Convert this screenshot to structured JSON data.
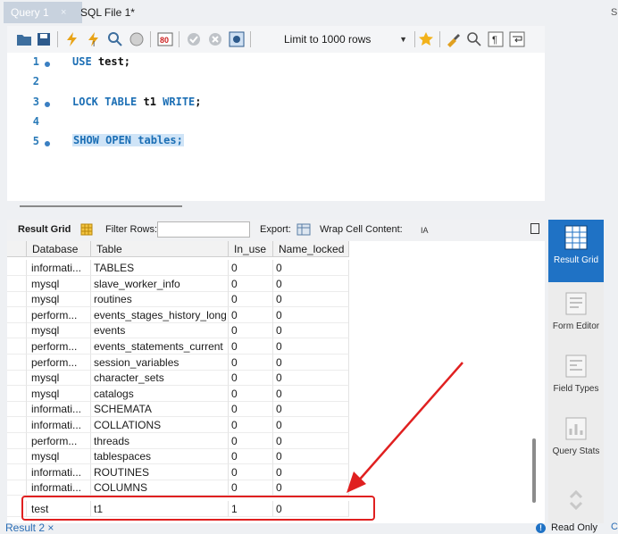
{
  "tabs": [
    {
      "label": "Query 1",
      "close": "×"
    },
    {
      "label": "SQL File 1*"
    }
  ],
  "tab_overflow": "S",
  "toolbar": {
    "limit_label": "Limit to 1000 rows"
  },
  "editor": {
    "lines": [
      {
        "number": "1",
        "parts": [
          {
            "t": "USE",
            "k": true
          },
          {
            "t": " test;",
            "k": false
          }
        ]
      },
      {
        "number": "2",
        "parts": []
      },
      {
        "number": "3",
        "parts": [
          {
            "t": "LOCK TABLE",
            "k": true
          },
          {
            "t": " t1 ",
            "k": false
          },
          {
            "t": "WRITE",
            "k": true
          },
          {
            "t": ";",
            "k": false
          }
        ]
      },
      {
        "number": "4",
        "parts": []
      },
      {
        "number": "5",
        "parts": [
          {
            "t": "SHOW OPEN",
            "k": true
          },
          {
            "t": " tables;",
            "k": false
          }
        ]
      }
    ]
  },
  "result_toolbar": {
    "result_grid": "Result Grid",
    "filter_rows": "Filter Rows:",
    "export": "Export:",
    "wrap": "Wrap Cell Content:"
  },
  "grid": {
    "columns": [
      "Database",
      "Table",
      "In_use",
      "Name_locked"
    ],
    "rows": [
      [
        "informati...",
        "TABLES",
        "0",
        "0"
      ],
      [
        "mysql",
        "slave_worker_info",
        "0",
        "0"
      ],
      [
        "mysql",
        "routines",
        "0",
        "0"
      ],
      [
        "perform...",
        "events_stages_history_long",
        "0",
        "0"
      ],
      [
        "mysql",
        "events",
        "0",
        "0"
      ],
      [
        "perform...",
        "events_statements_current",
        "0",
        "0"
      ],
      [
        "perform...",
        "session_variables",
        "0",
        "0"
      ],
      [
        "mysql",
        "character_sets",
        "0",
        "0"
      ],
      [
        "mysql",
        "catalogs",
        "0",
        "0"
      ],
      [
        "informati...",
        "SCHEMATA",
        "0",
        "0"
      ],
      [
        "informati...",
        "COLLATIONS",
        "0",
        "0"
      ],
      [
        "perform...",
        "threads",
        "0",
        "0"
      ],
      [
        "mysql",
        "tablespaces",
        "0",
        "0"
      ],
      [
        "informati...",
        "ROUTINES",
        "0",
        "0"
      ],
      [
        "informati...",
        "COLUMNS",
        "0",
        "0"
      ],
      [
        "test",
        "t1",
        "1",
        "0"
      ]
    ]
  },
  "bottom": {
    "result_tab": "Result 2",
    "close": "×",
    "read_only": "Read Only",
    "edge": "C"
  },
  "side_panel": [
    {
      "label": "Result Grid",
      "active": true
    },
    {
      "label": "Form Editor"
    },
    {
      "label": "Field Types"
    },
    {
      "label": "Query Stats"
    }
  ],
  "colors": {
    "accent": "#1f72c5",
    "highlight": "#e02020",
    "keyword": "#1c6fb5"
  }
}
